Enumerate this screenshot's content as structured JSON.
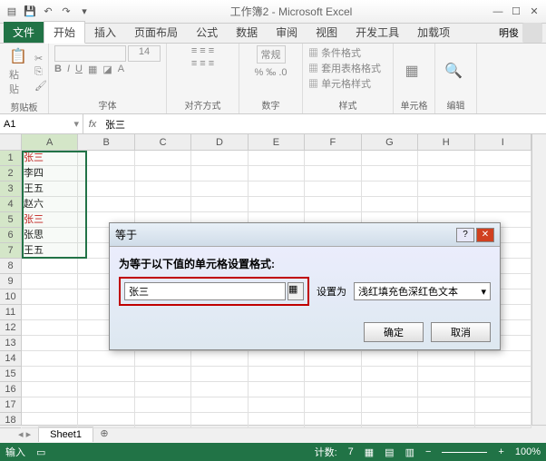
{
  "title": "工作簿2 - Microsoft Excel",
  "user": "明俊",
  "tabs": {
    "file": "文件",
    "home": "开始",
    "insert": "插入",
    "layout": "页面布局",
    "formulas": "公式",
    "data": "数据",
    "review": "审阅",
    "view": "视图",
    "dev": "开发工具",
    "addins": "加载项"
  },
  "ribbon": {
    "clipboard": {
      "label": "剪贴板",
      "paste": "粘贴"
    },
    "font": {
      "label": "字体"
    },
    "align": {
      "label": "对齐方式",
      "wrap": "常规"
    },
    "number": {
      "label": "数字"
    },
    "styles": {
      "label": "样式",
      "conditional": "条件格式",
      "table": "套用表格格式",
      "cell": "单元格样式"
    },
    "cells": {
      "label": "单元格"
    },
    "editing": {
      "label": "编辑"
    }
  },
  "namebox": "A1",
  "formula": "张三",
  "columns": [
    "A",
    "B",
    "C",
    "D",
    "E",
    "F",
    "G",
    "H",
    "I"
  ],
  "rows": [
    "1",
    "2",
    "3",
    "4",
    "5",
    "6",
    "7",
    "8",
    "9",
    "10",
    "11",
    "12",
    "13",
    "14",
    "15",
    "16",
    "17",
    "18"
  ],
  "data_a": [
    "张三",
    "李四",
    "王五",
    "赵六",
    "张三",
    "张思",
    "王五"
  ],
  "sheet": "Sheet1",
  "dialog": {
    "title": "等于",
    "label": "为等于以下值的单元格设置格式:",
    "value": "张三",
    "setas": "设置为",
    "format": "浅红填充色深红色文本",
    "ok": "确定",
    "cancel": "取消"
  },
  "status": {
    "mode": "输入",
    "count_label": "计数:",
    "count": "7",
    "zoom": "100%"
  }
}
